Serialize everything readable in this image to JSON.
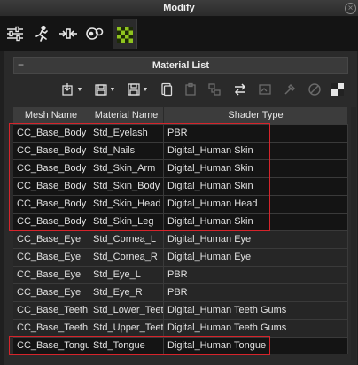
{
  "window": {
    "title": "Modify",
    "close_glyph": "×"
  },
  "tabs": [
    {
      "icon": "sliders-icon"
    },
    {
      "icon": "running-figure-icon"
    },
    {
      "icon": "morph-icon"
    },
    {
      "icon": "palette-icon"
    },
    {
      "icon": "checker-material-icon",
      "active": true
    }
  ],
  "section": {
    "title": "Material List",
    "collapse_glyph": "−"
  },
  "toolbar_icons": [
    "load-material-icon",
    "save-material-icon",
    "save-all-icon",
    "copy-icon",
    "paste-icon",
    "paste-all-icon",
    "swap-icon",
    "texture-icon",
    "eyedropper-icon",
    "channel-icon",
    "checker-icon"
  ],
  "table": {
    "columns": [
      "Mesh Name",
      "Material Name",
      "Shader Type"
    ],
    "rows": [
      [
        "CC_Base_Body",
        "Std_Eyelash",
        "PBR"
      ],
      [
        "CC_Base_Body",
        "Std_Nails",
        "Digital_Human Skin"
      ],
      [
        "CC_Base_Body",
        "Std_Skin_Arm",
        "Digital_Human Skin"
      ],
      [
        "CC_Base_Body",
        "Std_Skin_Body",
        "Digital_Human Skin"
      ],
      [
        "CC_Base_Body",
        "Std_Skin_Head",
        "Digital_Human Head"
      ],
      [
        "CC_Base_Body",
        "Std_Skin_Leg",
        "Digital_Human Skin"
      ],
      [
        "CC_Base_Eye",
        "Std_Cornea_L",
        "Digital_Human Eye"
      ],
      [
        "CC_Base_Eye",
        "Std_Cornea_R",
        "Digital_Human Eye"
      ],
      [
        "CC_Base_Eye",
        "Std_Eye_L",
        "PBR"
      ],
      [
        "CC_Base_Eye",
        "Std_Eye_R",
        "PBR"
      ],
      [
        "CC_Base_Teeth",
        "Std_Lower_Teeth",
        "Digital_Human Teeth Gums"
      ],
      [
        "CC_Base_Teeth",
        "Std_Upper_Teeth",
        "Digital_Human Teeth Gums"
      ],
      [
        "CC_Base_Tongue",
        "Std_Tongue",
        "Digital_Human Tongue"
      ]
    ],
    "highlighted_rows": [
      0,
      1,
      2,
      3,
      4,
      5,
      12
    ]
  },
  "colors": {
    "highlight_border": "#d6242b",
    "row_dark": "#141414",
    "row_mid": "#262626",
    "accent_green": "#8fc41f"
  }
}
